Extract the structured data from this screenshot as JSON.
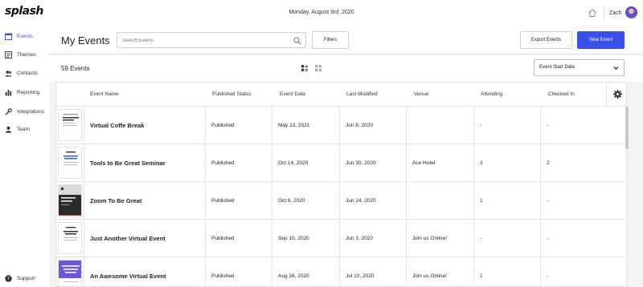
{
  "app": {
    "logo": "splash",
    "date": "Monday, August 3rd, 2020",
    "user": "Zach"
  },
  "sidebar": {
    "items": [
      {
        "label": "Events",
        "icon": "calendar-icon",
        "active": true
      },
      {
        "label": "Themes",
        "icon": "themes-icon",
        "active": false
      },
      {
        "label": "Contacts",
        "icon": "contacts-icon",
        "active": false
      },
      {
        "label": "Reporting",
        "icon": "bar-chart-icon",
        "active": false
      },
      {
        "label": "Integrations",
        "icon": "wrench-icon",
        "active": false
      },
      {
        "label": "Team",
        "icon": "team-icon",
        "active": false
      }
    ],
    "support": "Support"
  },
  "header": {
    "title": "My Events",
    "search_placeholder": "Search Events",
    "filters": "Filters",
    "export": "Export Events",
    "new_event": "New Event"
  },
  "subheader": {
    "count": "59 Events",
    "sort": "Event Start Date"
  },
  "table": {
    "columns": [
      "Event Name",
      "Published Status",
      "Event Date",
      "Last Modified",
      "Venue",
      "Attending",
      "Checked In"
    ],
    "rows": [
      {
        "name": "Virtual Coffe Break",
        "status": "Published",
        "date": "May 13, 2021",
        "modified": "Jun 8, 2020",
        "venue": "",
        "attending": "-",
        "checked": "-",
        "thumb": "doc"
      },
      {
        "name": "Tools to Be Great Seminar",
        "status": "Published",
        "date": "Oct 14, 2020",
        "modified": "Jun 30, 2020",
        "venue": "Ace Hotel",
        "attending": "3",
        "checked": "2",
        "thumb": "doc-blue"
      },
      {
        "name": "Zoom To Be Great",
        "status": "Published",
        "date": "Oct 6, 2020",
        "modified": "Jun 24, 2020",
        "venue": "",
        "attending": "1",
        "checked": "-",
        "thumb": "dark"
      },
      {
        "name": "Just Another Virtual Event",
        "status": "Published",
        "date": "Sep 10, 2020",
        "modified": "Jun 3, 2020",
        "venue": "Join us Online!",
        "attending": "-",
        "checked": "-",
        "thumb": "doc"
      },
      {
        "name": "An Awesome Virtual Event",
        "status": "Published",
        "date": "Aug 26, 2020",
        "modified": "Jul 10, 2020",
        "venue": "Join us Online!",
        "attending": "1",
        "checked": "-",
        "thumb": "purple"
      }
    ]
  },
  "colors": {
    "accent": "#3b50e8",
    "active_nav": "#3b4be0"
  }
}
